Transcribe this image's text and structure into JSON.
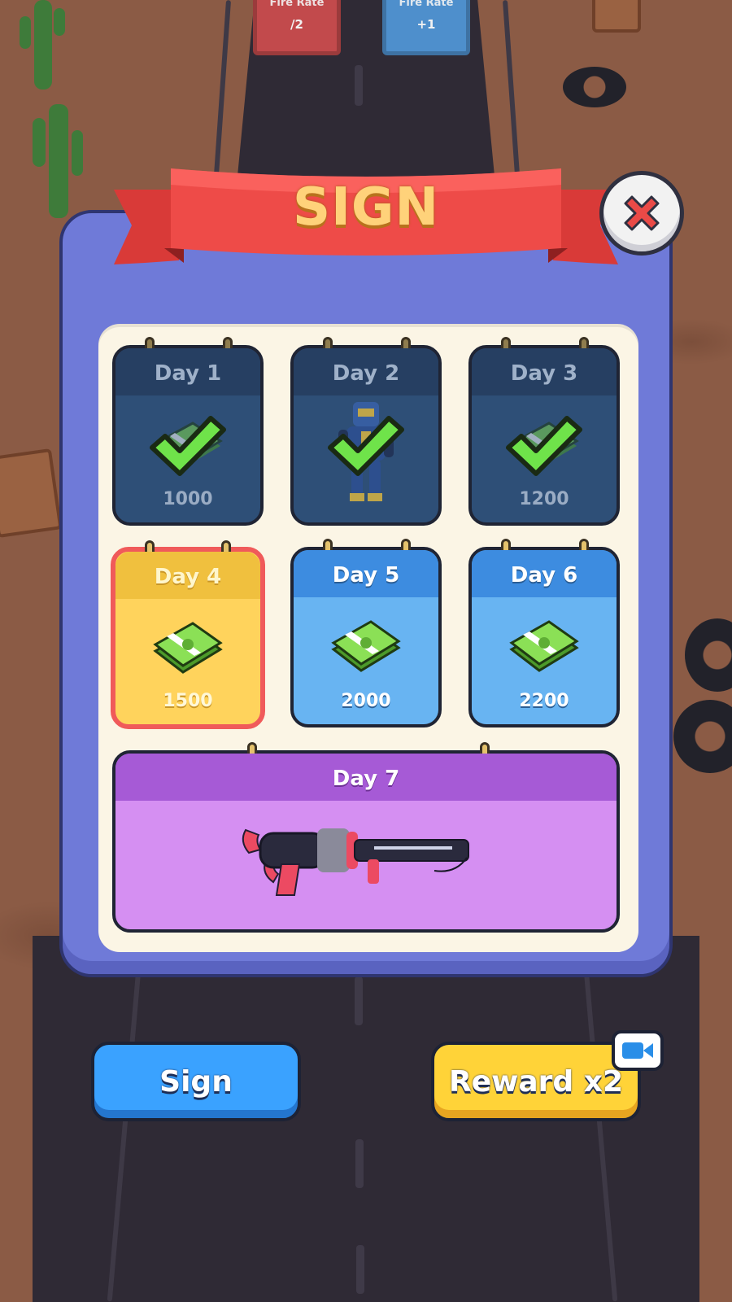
{
  "background": {
    "gates": [
      {
        "title": "Fire Rate",
        "value": "/2"
      },
      {
        "title": "Fire Rate",
        "value": "+1"
      }
    ]
  },
  "dialog": {
    "title": "SIGN",
    "close_icon": "close-x-icon",
    "days": [
      {
        "label": "Day 1",
        "amount": "1000",
        "reward_icon": "cash-stack-icon",
        "state": "claimed"
      },
      {
        "label": "Day 2",
        "amount": "",
        "reward_icon": "robot-character-icon",
        "state": "claimed"
      },
      {
        "label": "Day 3",
        "amount": "1200",
        "reward_icon": "cash-stack-icon",
        "state": "claimed"
      },
      {
        "label": "Day 4",
        "amount": "1500",
        "reward_icon": "cash-stack-icon",
        "state": "today"
      },
      {
        "label": "Day 5",
        "amount": "2000",
        "reward_icon": "cash-stack-icon",
        "state": "locked"
      },
      {
        "label": "Day 6",
        "amount": "2200",
        "reward_icon": "cash-stack-icon",
        "state": "locked"
      },
      {
        "label": "Day 7",
        "amount": "",
        "reward_icon": "blaster-gun-icon",
        "state": "locked"
      }
    ]
  },
  "buttons": {
    "sign_label": "Sign",
    "reward_label": "Reward x2",
    "reward_badge_icon": "video-camera-icon"
  },
  "colors": {
    "dialog": "#6f7ad8",
    "ribbon": "#e8423f",
    "today_border": "#f05a5a",
    "sign_button": "#3aa2ff",
    "reward_button": "#ffd338",
    "day7": "#d58ff2"
  }
}
